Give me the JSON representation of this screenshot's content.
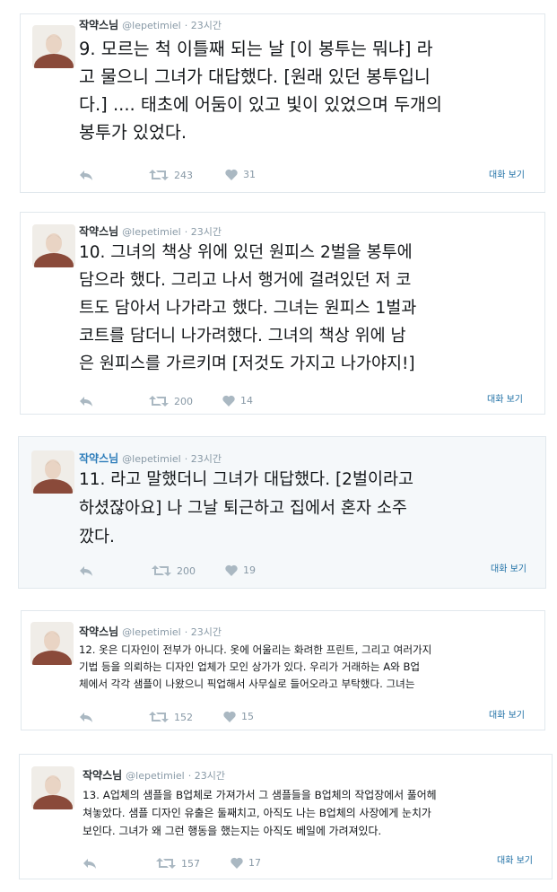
{
  "tweets": [
    {
      "author_name": "작약스님",
      "handle": "@lepetimiel",
      "time": "· 23시간",
      "lines": [
        "9. 모르는 척 이틀째 되는 날 [이 봉투는 뭐냐] 라",
        "고 물으니 그녀가 대답했다. [원래 있던 봉투입니",
        "다.] .... 태초에 어둠이 있고 빛이 있었으며 두개의",
        "봉투가 있었다."
      ],
      "retweets": "243",
      "likes": "31",
      "convo_label": "대화 보기"
    },
    {
      "author_name": "작약스님",
      "handle": "@lepetimiel",
      "time": "· 23시간",
      "lines": [
        "10. 그녀의 책상 위에 있던 원피스 2벌을 봉투에",
        "담으라 했다. 그리고 나서 행거에 걸려있던 저 코",
        "트도 담아서 나가라고 했다. 그녀는 원피스 1벌과",
        "코트를 담더니 나가려했다. 그녀의 책상 위에 남",
        "은 원피스를 가르키며 [저것도 가지고 나가야지!]"
      ],
      "retweets": "200",
      "likes": "14",
      "convo_label": "대화 보기"
    },
    {
      "author_name": "작약스님",
      "handle": "@lepetimiel",
      "time": "· 23시간",
      "lines": [
        "11. 라고 말했더니 그녀가 대답했다. [2벌이라고",
        "하셨잖아요] 나 그날 퇴근하고 집에서 혼자 소주",
        "깠다."
      ],
      "retweets": "200",
      "likes": "19",
      "convo_label": "대화 보기"
    },
    {
      "author_name": "작약스님",
      "handle": "@lepetimiel",
      "time": "· 23시간",
      "lines": [
        "12. 옷은 디자인이 전부가 아니다. 옷에 어울리는 화려한 프린트, 그리고 여러가지",
        "기법 등을 의뢰하는 디자인 업체가 모인 상가가 있다.  우리가 거래하는 A와 B업",
        "체에서 각각 샘플이 나왔으니 픽업해서 사무실로 들어오라고 부탁했다. 그녀는"
      ],
      "retweets": "152",
      "likes": "15",
      "convo_label": "대화 보기"
    },
    {
      "author_name": "작약스님",
      "handle": "@lepetimiel",
      "time": "· 23시간",
      "lines": [
        "13. A업체의 샘플을 B업체로 가져가서 그 샘플들을 B업체의 작업장에서 풀어헤",
        "쳐놓았다. 샘플 디자인 유출은 둘째치고, 아직도 나는 B업체의 사장에게 눈치가",
        "보인다. 그녀가 왜 그런 행동을 했는지는 아직도 베일에 가려져있다."
      ],
      "retweets": "157",
      "likes": "17",
      "convo_label": "대화 보기"
    }
  ],
  "colors": {
    "border": "#e1e8ed",
    "highlight_bg": "#f5f8fa",
    "link": "#1d6fa5",
    "icon": "#aab8c2",
    "meta": "#8899a6"
  },
  "icons": [
    "reply-icon",
    "retweet-icon",
    "like-icon"
  ]
}
